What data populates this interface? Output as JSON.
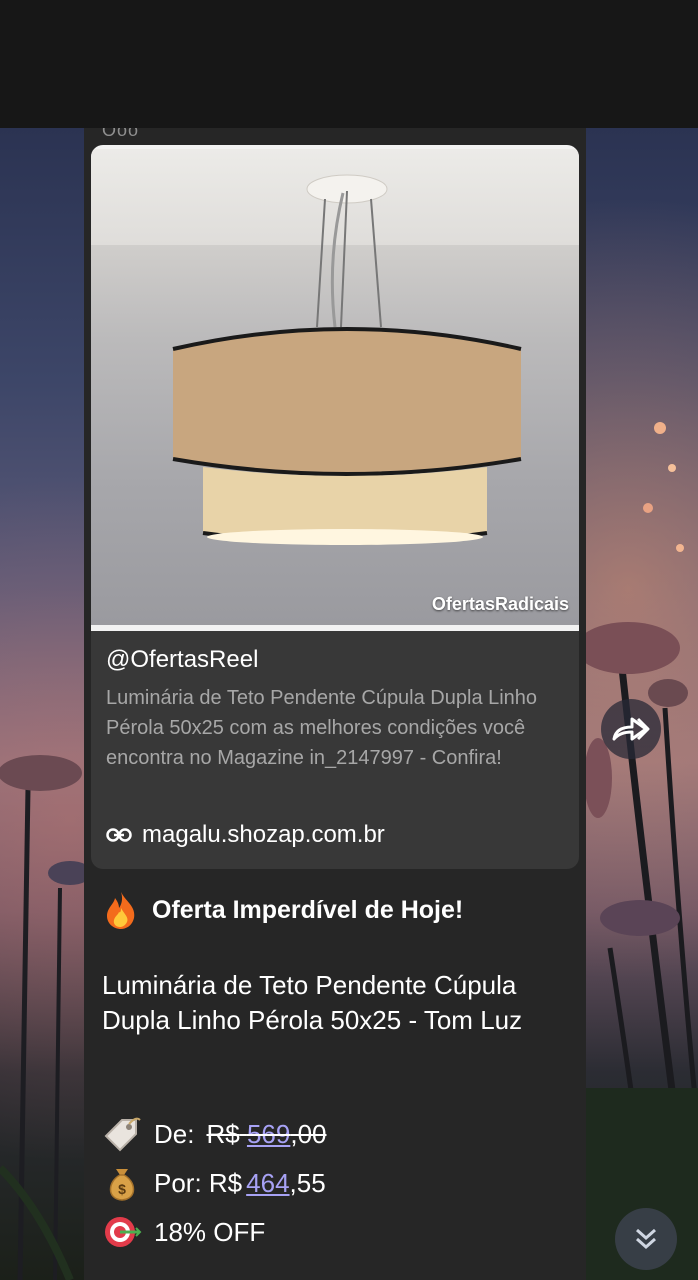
{
  "status_bar": {},
  "preview": {
    "watermark": "OfertasRadicais",
    "site_name": "@OfertasReel",
    "description": "Luminária de Teto Pendente Cúpula Dupla Linho Pérola 50x25 com as melhores condições você encontra no Magazine in_2147997 - Confira!",
    "link": "magalu.shozap.com.br"
  },
  "message": {
    "sender_fragment": "Ооо",
    "headline": "Oferta Imperdível de Hoje!",
    "product_name": "Luminária de Teto Pendente Cúpula Dupla Linho Pérola 50x25 - Tom Luz",
    "old_price": {
      "label": "De:",
      "currency": "R$",
      "amount": "569",
      "cents": ",00"
    },
    "new_price": {
      "label": "Por: R$",
      "amount": "464",
      "cents": ",55"
    },
    "discount": "18% OFF"
  },
  "icons": {
    "headline": "fire-icon",
    "old_price": "price-tag-icon",
    "new_price": "money-bag-icon",
    "discount": "target-icon",
    "share": "forward-share-icon",
    "scroll_down": "double-chevron-down-icon",
    "link": "link-icon"
  },
  "colors": {
    "bubble": "#262626",
    "link_number": "#a7a2f5",
    "preview_card": "#383838"
  }
}
